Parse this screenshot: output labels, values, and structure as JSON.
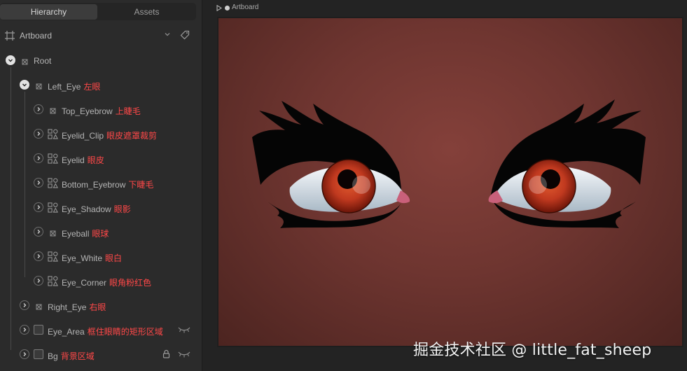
{
  "tabs": {
    "hierarchy": "Hierarchy",
    "assets": "Assets"
  },
  "artboard": {
    "label": "Artboard"
  },
  "tree": [
    {
      "name": "Root",
      "cn": "",
      "level": 0,
      "toggle": "open",
      "icon": "group"
    },
    {
      "name": "Left_Eye",
      "cn": "左眼",
      "level": 1,
      "toggle": "open",
      "icon": "group"
    },
    {
      "name": "Top_Eyebrow",
      "cn": "上睫毛",
      "level": 2,
      "toggle": "closed",
      "icon": "group"
    },
    {
      "name": "Eyelid_Clip",
      "cn": "眼皮遮罩裁剪",
      "level": 2,
      "toggle": "closed",
      "icon": "shapes"
    },
    {
      "name": "Eyelid",
      "cn": "眼皮",
      "level": 2,
      "toggle": "closed",
      "icon": "shapes"
    },
    {
      "name": "Bottom_Eyebrow",
      "cn": "下睫毛",
      "level": 2,
      "toggle": "closed",
      "icon": "shapes"
    },
    {
      "name": "Eye_Shadow",
      "cn": "眼影",
      "level": 2,
      "toggle": "closed",
      "icon": "shapes"
    },
    {
      "name": "Eyeball",
      "cn": "眼球",
      "level": 2,
      "toggle": "closed",
      "icon": "group"
    },
    {
      "name": "Eye_White",
      "cn": "眼白",
      "level": 2,
      "toggle": "closed",
      "icon": "shapes"
    },
    {
      "name": "Eye_Corner",
      "cn": "眼角粉红色",
      "level": 2,
      "toggle": "closed",
      "icon": "shapes"
    },
    {
      "name": "Right_Eye",
      "cn": "右眼",
      "level": 1,
      "toggle": "closed",
      "icon": "group"
    },
    {
      "name": "Eye_Area",
      "cn": "框住眼睛的矩形区域",
      "level": 1,
      "toggle": "closed",
      "icon": "checkbox",
      "hidden": true
    },
    {
      "name": "Bg",
      "cn": "背景区域",
      "level": 1,
      "toggle": "closed",
      "icon": "checkbox",
      "locked": true,
      "hidden": true
    }
  ],
  "canvas": {
    "breadcrumb": "Artboard"
  },
  "watermark": "掘金技术社区 @ little_fat_sheep",
  "colors": {
    "background": "#84403a",
    "iris": "#c0391f",
    "cn_label": "#ff4848"
  }
}
